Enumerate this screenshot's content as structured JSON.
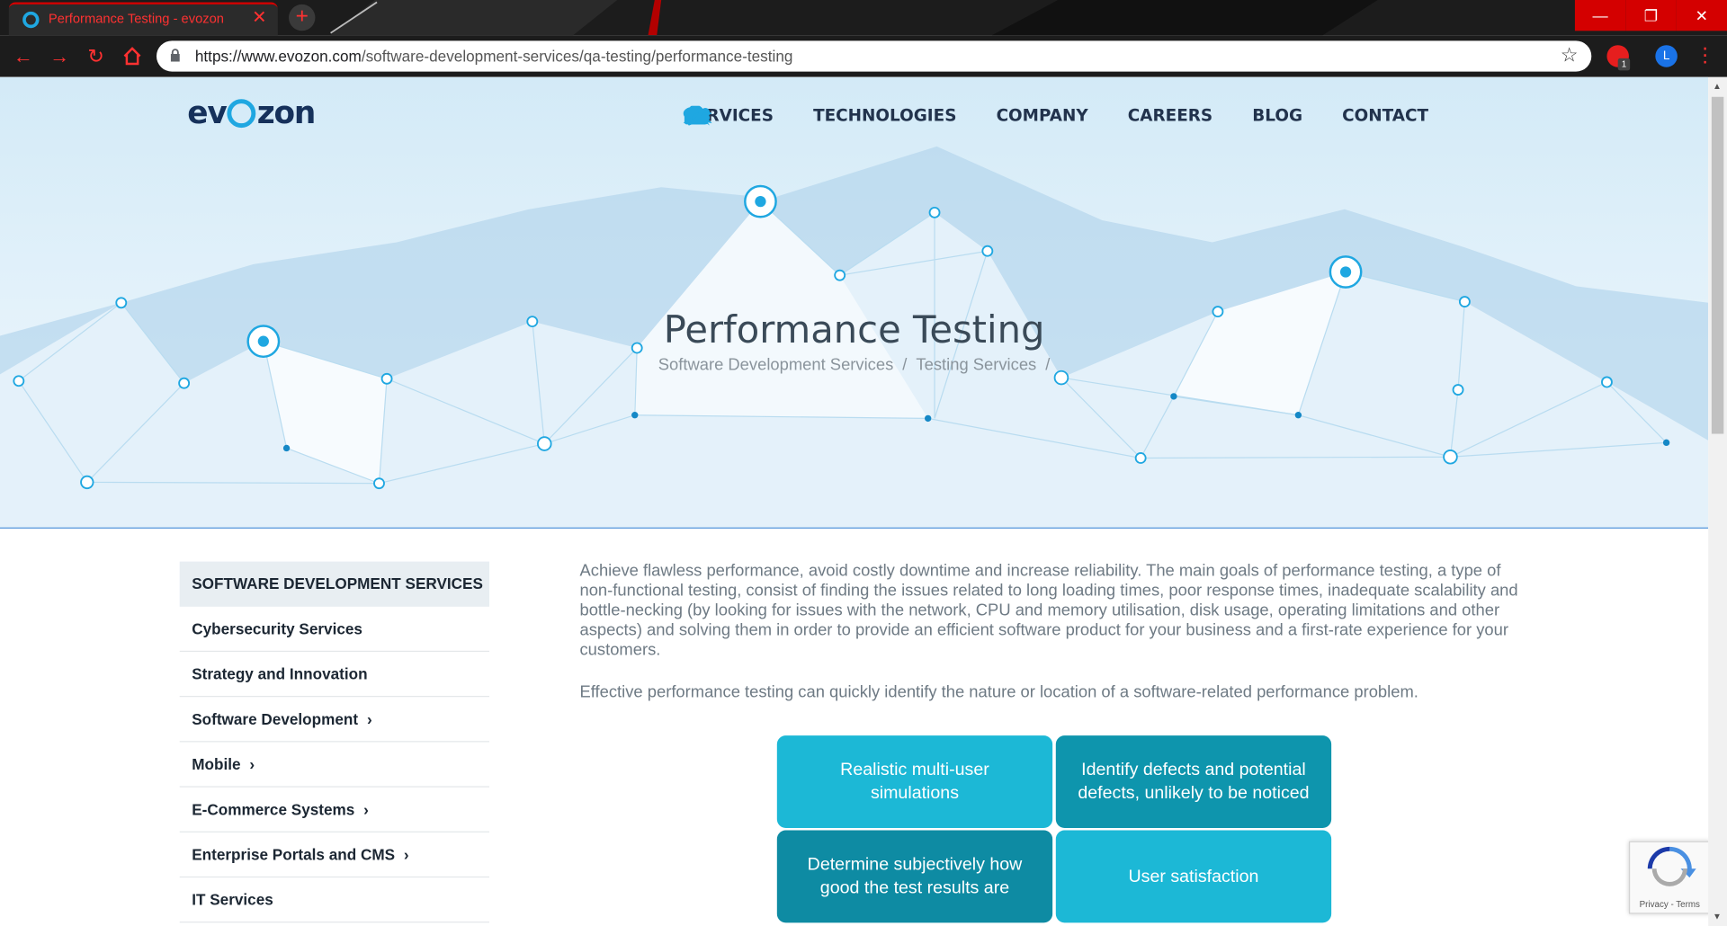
{
  "browser": {
    "tab_title": "Performance Testing - evozon",
    "tab_close": "✕",
    "new_tab": "+",
    "url_host": "https://www.evozon.com",
    "url_path": "/software-development-services/qa-testing/performance-testing",
    "profile_initial": "L",
    "ext_badge": "1",
    "window_buttons": [
      "—",
      "❐",
      "✕"
    ]
  },
  "site": {
    "logo_left": "ev",
    "logo_right": "zon",
    "nav": [
      {
        "label": "SERVICES",
        "icon": "briefcase-icon"
      },
      {
        "label": "TECHNOLOGIES",
        "icon": "gears-icon"
      },
      {
        "label": "COMPANY",
        "icon": "users-icon"
      },
      {
        "label": "CAREERS",
        "icon": "graduation-cap-icon"
      },
      {
        "label": "BLOG",
        "icon": "comments-icon"
      },
      {
        "label": "CONTACT",
        "icon": "phone-icon"
      }
    ],
    "accent_color": "#1fa7e1"
  },
  "hero": {
    "title": "Performance Testing",
    "breadcrumb": [
      "Software Development Services",
      "/",
      "Testing Services",
      "/"
    ]
  },
  "sidebar": {
    "heading": "SOFTWARE DEVELOPMENT SERVICES",
    "items": [
      {
        "label": "Cybersecurity Services",
        "chevron": ""
      },
      {
        "label": "Strategy and Innovation",
        "chevron": ""
      },
      {
        "label": "Software Development",
        "chevron": "›"
      },
      {
        "label": "Mobile",
        "chevron": "›"
      },
      {
        "label": "E-Commerce Systems",
        "chevron": "›"
      },
      {
        "label": "Enterprise Portals and CMS",
        "chevron": "›"
      },
      {
        "label": "IT Services",
        "chevron": ""
      }
    ]
  },
  "content": {
    "paragraph1": "Achieve flawless performance, avoid costly downtime and increase reliability. The main goals of performance testing, a type of non-functional testing, consist of finding the issues related to long loading times, poor response times, inadequate scalability and bottle-necking (by looking for issues with the network, CPU and memory utilisation, disk usage, operating limitations and other aspects) and solving them in order to provide an efficient software product for your business and a first-rate experience for your customers.",
    "paragraph2": "Effective performance testing can quickly identify the nature or location of a software-related performance problem.",
    "tiles": [
      "Realistic multi-user simulations",
      "Identify defects and potential defects, unlikely to be noticed",
      "Determine subjectively how good the test results are",
      "User satisfaction"
    ]
  },
  "recaptcha": {
    "text": "Privacy - Terms"
  }
}
